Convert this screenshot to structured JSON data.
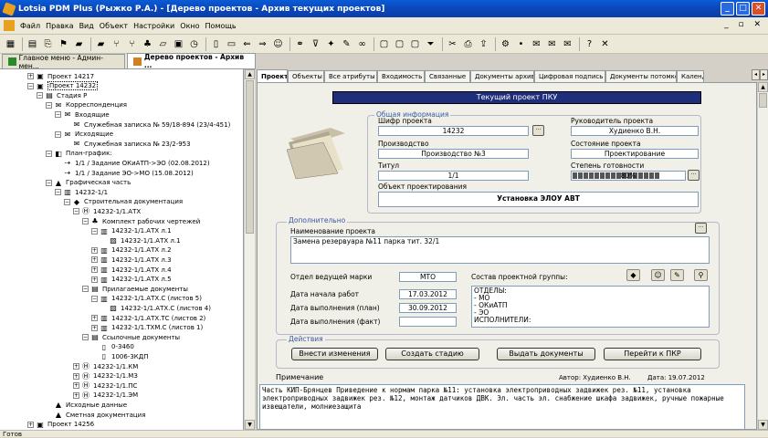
{
  "window": {
    "title": "Lotsia PDM Plus (Рыжко Р.А.) - [Дерево проектов - Архив текущих проектов]"
  },
  "menu": [
    "Файл",
    "Правка",
    "Вид",
    "Объект",
    "Настройки",
    "Окно",
    "Помощь"
  ],
  "toolbar_icons": [
    "grid-icon",
    "table-icon",
    "copy-icon",
    "flag-icon",
    "folder-icon",
    "folder-add-icon",
    "branch-icon",
    "branch2-icon",
    "tree-icon",
    "folder-open-icon",
    "image-icon",
    "clock-icon",
    "doc-icon",
    "open-icon",
    "arrow-left-icon",
    "arrow-right-icon",
    "user-icon",
    "link-icon",
    "filter-icon",
    "star-icon",
    "pen-icon",
    "binoculars-icon",
    "square-icon",
    "square2-icon",
    "square3-icon",
    "funnel-icon",
    "scissors-icon",
    "print-icon",
    "export-icon",
    "settings-icon",
    "pin-icon",
    "mail-icon",
    "mail2-icon",
    "mail3-icon",
    "help-icon",
    "close-icon"
  ],
  "doc_tabs": [
    "Главное меню - Админ-мен...",
    "Дерево проектов - Архив ..."
  ],
  "tree": [
    {
      "label": "Проект 14217",
      "indent": 0,
      "exp": "+"
    },
    {
      "label": "Проект 14232",
      "indent": 0,
      "exp": "-",
      "selected": true
    },
    {
      "label": "Стадия Р",
      "indent": 1,
      "exp": "-"
    },
    {
      "label": "Корреспонденция",
      "indent": 2,
      "exp": "-"
    },
    {
      "label": "Входящие",
      "indent": 3,
      "exp": "-"
    },
    {
      "label": "Служебная записка № 59/18-894 (23/4-451)",
      "indent": 4,
      "exp": ""
    },
    {
      "label": "Исходящие",
      "indent": 3,
      "exp": "-"
    },
    {
      "label": "Служебная записка № 23/2-953",
      "indent": 4,
      "exp": ""
    },
    {
      "label": "План-график:",
      "indent": 2,
      "exp": "-"
    },
    {
      "label": "1/1 / Задание ОКиАТП->ЭО (02.08.2012)",
      "indent": 3,
      "exp": ""
    },
    {
      "label": "1/1 / Задание ЭО->МО (15.08.2012)",
      "indent": 3,
      "exp": ""
    },
    {
      "label": "Графическая часть",
      "indent": 2,
      "exp": "-"
    },
    {
      "label": "14232-1/1",
      "indent": 3,
      "exp": "-"
    },
    {
      "label": "Строительная документация",
      "indent": 4,
      "exp": "-"
    },
    {
      "label": "14232-1/1.АТХ",
      "indent": 5,
      "exp": "-"
    },
    {
      "label": "Комплект рабочих чертежей",
      "indent": 6,
      "exp": "-"
    },
    {
      "label": "14232-1/1.АТХ л.1",
      "indent": 7,
      "exp": "-"
    },
    {
      "label": "14232-1/1.АТХ л.1",
      "indent": 8,
      "exp": ""
    },
    {
      "label": "14232-1/1.АТХ л.2",
      "indent": 7,
      "exp": "+"
    },
    {
      "label": "14232-1/1.АТХ л.3",
      "indent": 7,
      "exp": "+"
    },
    {
      "label": "14232-1/1.АТХ л.4",
      "indent": 7,
      "exp": "+"
    },
    {
      "label": "14232-1/1.АТХ л.5",
      "indent": 7,
      "exp": "+"
    },
    {
      "label": "Прилагаемые документы",
      "indent": 6,
      "exp": "-"
    },
    {
      "label": "14232-1/1.АТХ.С (листов 5)",
      "indent": 7,
      "exp": "-"
    },
    {
      "label": "14232-1/1.АТХ.С (листов 4)",
      "indent": 8,
      "exp": ""
    },
    {
      "label": "14232-1/1.АТХ.ТС (листов 2)",
      "indent": 7,
      "exp": "+"
    },
    {
      "label": "14232-1/1.ТХМ.С (листов 1)",
      "indent": 7,
      "exp": "+"
    },
    {
      "label": "Ссылочные документы",
      "indent": 6,
      "exp": "-"
    },
    {
      "label": "0-3460",
      "indent": 7,
      "exp": ""
    },
    {
      "label": "1006-3КДП",
      "indent": 7,
      "exp": ""
    },
    {
      "label": "14232-1/1.КМ",
      "indent": 5,
      "exp": "+"
    },
    {
      "label": "14232-1/1.МЗ",
      "indent": 5,
      "exp": "+"
    },
    {
      "label": "14232-1/1.ПС",
      "indent": 5,
      "exp": "+"
    },
    {
      "label": "14232-1/1.ЭМ",
      "indent": 5,
      "exp": "+"
    },
    {
      "label": "Исходные данные",
      "indent": 2,
      "exp": ""
    },
    {
      "label": "Сметная документация",
      "indent": 2,
      "exp": ""
    },
    {
      "label": "Проект 14256",
      "indent": 0,
      "exp": "+"
    }
  ],
  "right_tabs": [
    "Проект",
    "Объекты",
    "Все атрибуты",
    "Входимость",
    "Связанные",
    "Документы архива",
    "Цифровая подпись",
    "Документы потомков",
    "Календ."
  ],
  "project": {
    "header": "Текущий проект ПКУ",
    "general_label": "Общая информация",
    "cipher_label": "Шифр проекта",
    "cipher": "14232",
    "manager_label": "Руководитель проекта",
    "manager": "Худиенко В.Н.",
    "production_label": "Производство",
    "production": "Производство №3",
    "state_label": "Состояние проекта",
    "state": "Проектирование",
    "title_label": "Титул",
    "title": "1/1",
    "readiness_label": "Степень готовности",
    "readiness": "80%",
    "readiness_value": 0.8,
    "object_label": "Объект проектирования",
    "object": "Установка ЭЛОУ АВТ",
    "additional_label": "Дополнительно",
    "name_label": "Наименование проекта",
    "name": "Замена резервуара №11 парка тит. 32/1",
    "dept_label": "Отдел ведущей марки",
    "dept": "МТО",
    "team_label": "Состав проектной группы:",
    "team": "ОТДЕЛЫ:\n- МО\n- ОКиАТП\n- ЭО\nИСПОЛНИТЕЛИ:",
    "start_label": "Дата начала работ",
    "start": "17.03.2012",
    "plan_label": "Дата выполнения (план)",
    "plan": "30.09.2012",
    "fact_label": "Дата выполнения (факт)",
    "fact": "",
    "actions_label": "Действия",
    "btn_edit": "Внести изменения",
    "btn_stage": "Создать стадию",
    "btn_issue": "Выдать документы",
    "btn_goto": "Перейти к ПКР",
    "note_label": "Примечание",
    "author": "Автор:  Худиенко В.Н.",
    "date": "Дата:  19.07.2012",
    "note": "Часть КИП-Брянцев Приведение к нормам парка №11: установка электроприводных задвижек рез. №11, установка электроприводных задвижек рез. №12, монтаж датчиков ДВК. Эл. часть эл. снабжение шкафа задвижек, ручные пожарные извещатели, молниезащита"
  },
  "status": "Готов"
}
